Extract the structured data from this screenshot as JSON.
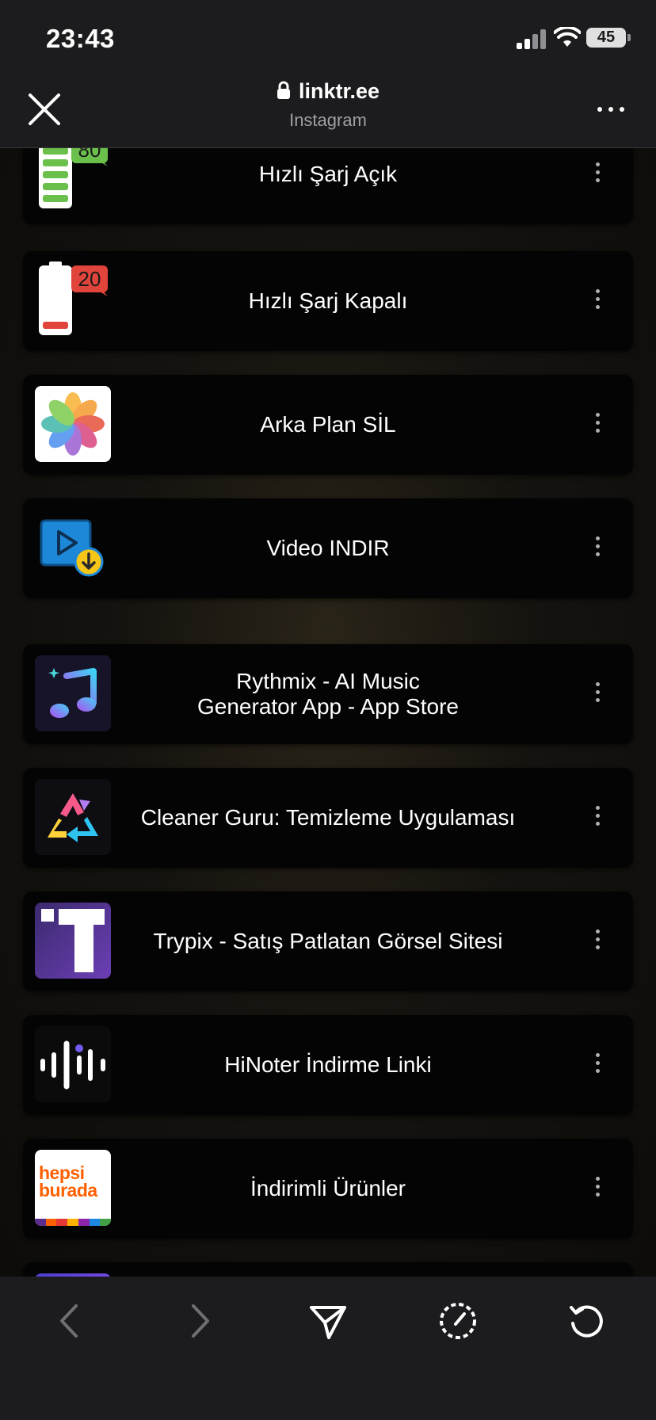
{
  "status_bar": {
    "time": "23:43",
    "battery": "45"
  },
  "browser": {
    "url": "linktr.ee",
    "subtitle": "Instagram"
  },
  "links": [
    {
      "title": "Hızlı Şarj Açık",
      "badge": "80",
      "icon": "battery-full-icon"
    },
    {
      "title": "Hızlı Şarj Kapalı",
      "badge": "20",
      "icon": "battery-low-icon"
    },
    {
      "title": "Arka Plan SİL",
      "icon": "photos-icon"
    },
    {
      "title": "Video INDIR",
      "icon": "video-download-icon"
    },
    {
      "title_line1": "Rythmix - AI Music",
      "title_line2": "Generator App - App Store",
      "icon": "music-note-icon"
    },
    {
      "title": "Cleaner Guru: Temizleme Uygulaması",
      "icon": "recycle-icon"
    },
    {
      "title": "Trypix - Satış Patlatan Görsel Sitesi",
      "icon": "trypix-logo-icon"
    },
    {
      "title": "HiNoter İndirme Linki",
      "icon": "audio-wave-icon"
    },
    {
      "title": "İndirimli Ürünler",
      "logo_line1": "hepsi",
      "logo_line2": "burada",
      "icon": "hepsiburada-logo-icon"
    }
  ],
  "toolbar": {
    "items": [
      "back-icon",
      "forward-icon",
      "share-icon",
      "safari-compass-icon",
      "reload-icon"
    ]
  },
  "colors": {
    "background": "#1c1c1e",
    "card": "#040404",
    "battery_green": "#6bc04b",
    "battery_red": "#e0443a",
    "hepsiburada_orange": "#ff6000"
  }
}
